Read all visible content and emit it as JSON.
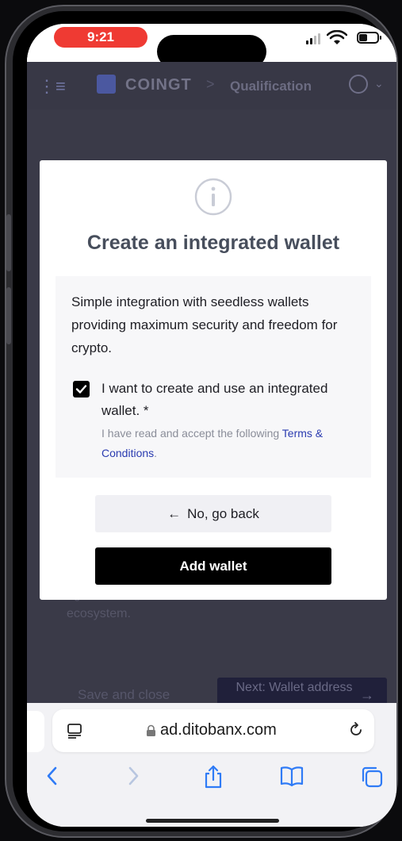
{
  "status_bar": {
    "time": "9:21"
  },
  "app_header": {
    "brand": "COINGT",
    "breadcrumb_sep": ">",
    "breadcrumb": "Qualification"
  },
  "background": {
    "text": "a unit of value and can represent various assets, rights, or functionalities within a blockchain ecosystem.",
    "save_close": "Save and close",
    "next": "Next: Wallet address",
    "next_arrow": "→"
  },
  "modal": {
    "title": "Create an integrated wallet",
    "description": "Simple integration with seedless wallets providing maximum security and freedom for crypto.",
    "checkbox_label": "I want to create and use an integrated wallet. *",
    "note_prefix": "I have read and accept the following ",
    "note_link": "Terms & Conditions",
    "note_suffix": ".",
    "checkbox_checked": true,
    "back_arrow": "←",
    "back_label": "No, go back",
    "add_label": "Add wallet"
  },
  "browser": {
    "url": "ad.ditobanx.com"
  },
  "colors": {
    "time_pill": "#ef3a33",
    "link": "#2a3bb0",
    "primary_button": "#000000",
    "toolbar_icons": "#2f7bf6"
  }
}
